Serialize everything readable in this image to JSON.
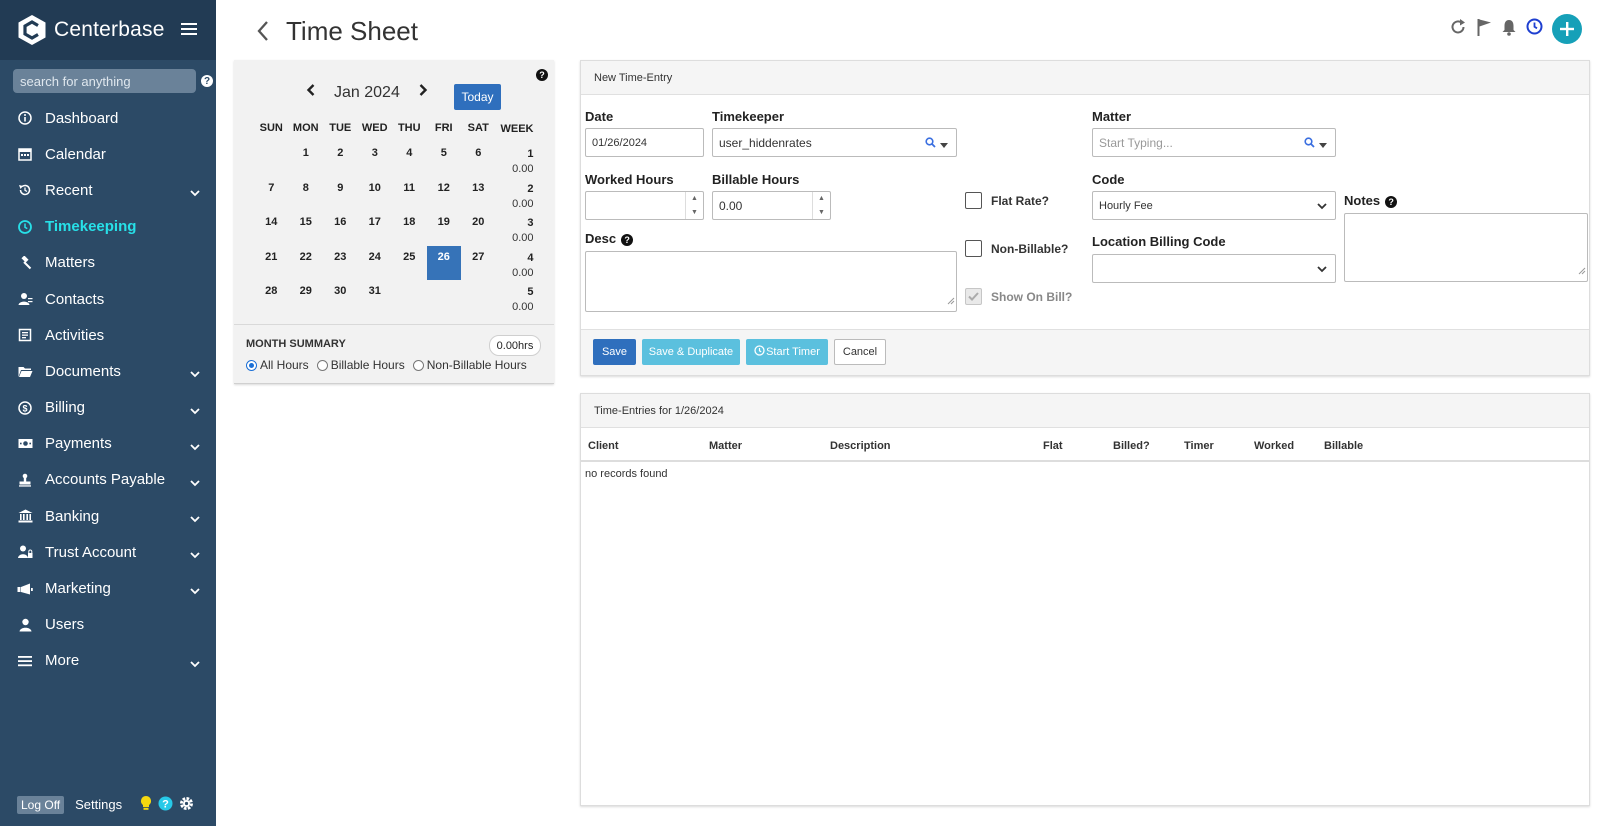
{
  "app": {
    "name": "Centerbase"
  },
  "sidebar": {
    "search_placeholder": "search for anything",
    "items": [
      {
        "label": "Dashboard",
        "icon": "info-icon",
        "expandable": false
      },
      {
        "label": "Calendar",
        "icon": "calendar-icon",
        "expandable": false
      },
      {
        "label": "Recent",
        "icon": "history-icon",
        "expandable": true
      },
      {
        "label": "Timekeeping",
        "icon": "clock-icon",
        "expandable": false,
        "active": true
      },
      {
        "label": "Matters",
        "icon": "gavel-icon",
        "expandable": false
      },
      {
        "label": "Contacts",
        "icon": "contacts-icon",
        "expandable": false
      },
      {
        "label": "Activities",
        "icon": "activities-icon",
        "expandable": false
      },
      {
        "label": "Documents",
        "icon": "folder-icon",
        "expandable": true
      },
      {
        "label": "Billing",
        "icon": "dollar-icon",
        "expandable": true
      },
      {
        "label": "Payments",
        "icon": "money-icon",
        "expandable": true
      },
      {
        "label": "Accounts Payable",
        "icon": "stamp-icon",
        "expandable": true
      },
      {
        "label": "Banking",
        "icon": "bank-icon",
        "expandable": true
      },
      {
        "label": "Trust Account",
        "icon": "trust-icon",
        "expandable": true
      },
      {
        "label": "Marketing",
        "icon": "megaphone-icon",
        "expandable": true
      },
      {
        "label": "Users",
        "icon": "user-icon",
        "expandable": false
      },
      {
        "label": "More",
        "icon": "list-icon",
        "expandable": true
      }
    ],
    "footer": {
      "logoff": "Log Off",
      "settings": "Settings"
    },
    "active_color": "#27e0e8"
  },
  "header": {
    "title": "Time Sheet"
  },
  "calendar": {
    "month_label": "Jan 2024",
    "today_label": "Today",
    "days": [
      "SUN",
      "MON",
      "TUE",
      "WED",
      "THU",
      "FRI",
      "SAT"
    ],
    "week_header": "WEEK",
    "weeks": [
      {
        "days": [
          "",
          "1",
          "2",
          "3",
          "4",
          "5",
          "6"
        ],
        "week": "1",
        "hours": "0.00"
      },
      {
        "days": [
          "7",
          "8",
          "9",
          "10",
          "11",
          "12",
          "13"
        ],
        "week": "2",
        "hours": "0.00"
      },
      {
        "days": [
          "14",
          "15",
          "16",
          "17",
          "18",
          "19",
          "20"
        ],
        "week": "3",
        "hours": "0.00"
      },
      {
        "days": [
          "21",
          "22",
          "23",
          "24",
          "25",
          "26",
          "27"
        ],
        "week": "4",
        "hours": "0.00"
      },
      {
        "days": [
          "28",
          "29",
          "30",
          "31",
          "",
          "",
          ""
        ],
        "week": "5",
        "hours": "0.00"
      }
    ],
    "selected_day": "26",
    "summary_label": "MONTH SUMMARY",
    "summary_hours": "0.00hrs",
    "filters": [
      {
        "label": "All Hours",
        "selected": true
      },
      {
        "label": "Billable Hours",
        "selected": false
      },
      {
        "label": "Non-Billable Hours",
        "selected": false
      }
    ]
  },
  "entry": {
    "panel_title": "New Time-Entry",
    "date_label": "Date",
    "date_value": "01/26/2024",
    "timekeeper_label": "Timekeeper",
    "timekeeper_value": "user_hiddenrates",
    "matter_label": "Matter",
    "matter_placeholder": "Start Typing...",
    "worked_label": "Worked Hours",
    "worked_value": "",
    "billable_label": "Billable Hours",
    "billable_value": "0.00",
    "flat_rate_label": "Flat Rate?",
    "non_billable_label": "Non-Billable?",
    "show_on_bill_label": "Show On Bill?",
    "code_label": "Code",
    "code_value": "Hourly Fee",
    "location_label": "Location Billing Code",
    "location_value": "",
    "notes_label": "Notes",
    "desc_label": "Desc",
    "buttons": {
      "save": "Save",
      "save_duplicate": "Save & Duplicate",
      "start_timer": "Start Timer",
      "cancel": "Cancel"
    }
  },
  "entries": {
    "panel_title": "Time-Entries for 1/26/2024",
    "columns": [
      "Client",
      "Matter",
      "Description",
      "Flat",
      "Billed?",
      "Timer",
      "Worked",
      "Billable"
    ],
    "empty_text": "no records found"
  },
  "colors": {
    "sidebar": "#2c4a66",
    "primary": "#2f6fbd",
    "info": "#5bc0de",
    "accent": "#16a0b8"
  }
}
